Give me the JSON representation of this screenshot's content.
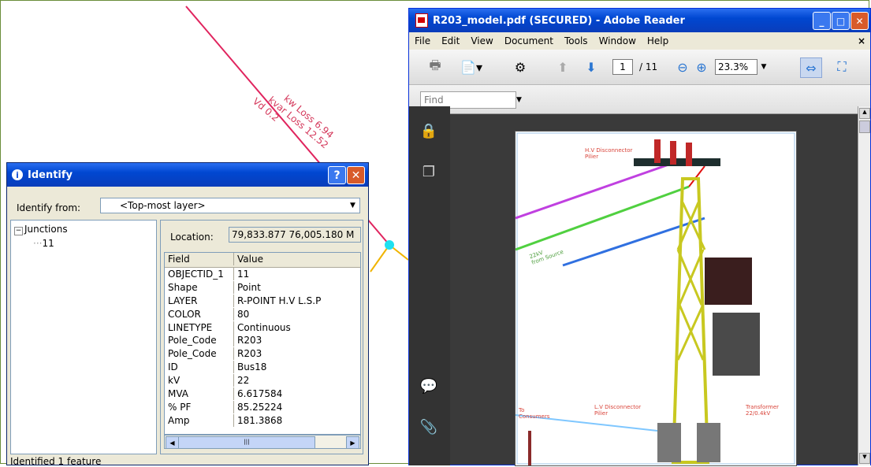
{
  "map": {
    "annotation_lines": [
      "kw Loss 6.94",
      "kvar Loss 12.52",
      "Vd 0.2"
    ]
  },
  "identify": {
    "title": "Identify",
    "help_label": "?",
    "identify_from_label": "Identify from:",
    "identify_from_value": "<Top-most layer>",
    "tree": {
      "root_label": "Junctions",
      "child_label": "11"
    },
    "location_label": "Location:",
    "location_value": "79,833.877  76,005.180 M",
    "columns": [
      "Field",
      "Value"
    ],
    "rows": [
      [
        "OBJECTID_1",
        "11"
      ],
      [
        "Shape",
        "Point"
      ],
      [
        "LAYER",
        "R-POINT H.V L.S.P"
      ],
      [
        "COLOR",
        "80"
      ],
      [
        "LINETYPE",
        "Continuous"
      ],
      [
        "Pole_Code",
        "R203"
      ],
      [
        "Pole_Code",
        "R203"
      ],
      [
        "ID",
        "Bus18"
      ],
      [
        "kV",
        "22"
      ],
      [
        "MVA",
        "6.617584"
      ],
      [
        "% PF",
        "85.25224"
      ],
      [
        "Amp",
        "181.3868"
      ]
    ],
    "status": "Identified 1 feature"
  },
  "reader": {
    "title": "R203_model.pdf (SECURED) - Adobe Reader",
    "menu": [
      "File",
      "Edit",
      "View",
      "Document",
      "Tools",
      "Window",
      "Help"
    ],
    "menu_close": "×",
    "page_current": "1",
    "page_total": "/ 11",
    "zoom": "23.3%",
    "find_placeholder": "Find",
    "drawing_labels": {
      "hv_disconnector": "H.V Disconnector\nPilier",
      "from_source": "22kV\nfrom Source",
      "lv_disconnector": "L.V Disconnector\nPilier",
      "transformer": "Transformer\n22/0.4kV",
      "to_consumers": "To\nConsumers"
    }
  },
  "colors": {
    "titlebar_blue": "#0047d1",
    "map_line": "#e0245e",
    "junction": "#1ee0f0",
    "tower": "#e8e410"
  }
}
